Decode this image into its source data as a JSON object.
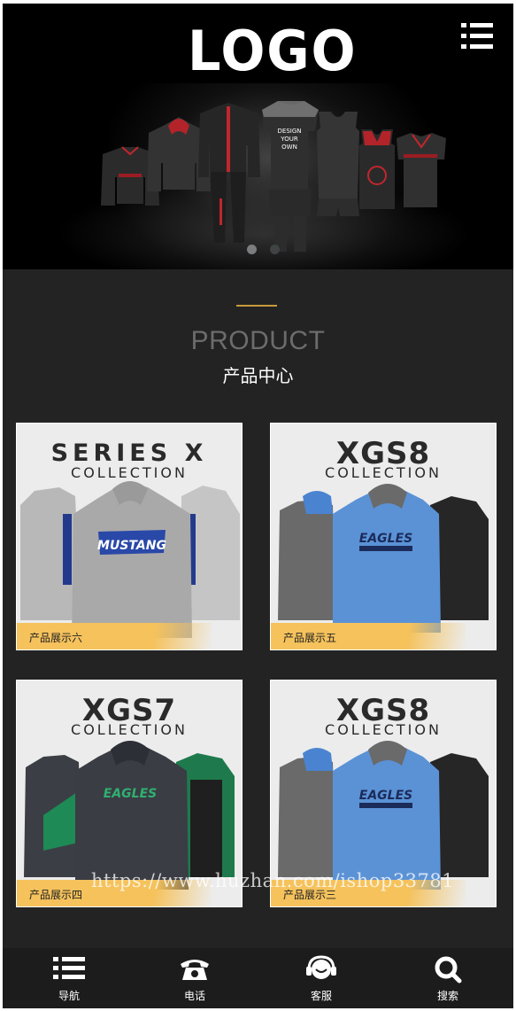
{
  "header": {
    "logo_text": "LOGO",
    "menu_icon": "menu-list-icon"
  },
  "banner": {
    "slide_count": 2,
    "active_slide": 1,
    "garment_texts": {
      "jersey_print": "DESIGN YOUR OWN"
    }
  },
  "section": {
    "title_en": "PRODUCT",
    "title_cn": "产品中心"
  },
  "products": [
    {
      "title": "SERIES X",
      "subtitle": "COLLECTION",
      "label": "产品展示六",
      "print": "MUSTANG",
      "colors": [
        "#b8b8b8",
        "#a9a9a9",
        "#c5c5c5"
      ]
    },
    {
      "title": "XGS8",
      "subtitle": "COLLECTION",
      "label": "产品展示五",
      "print": "EAGLES",
      "colors": [
        "#6a6a6a",
        "#5b92d6",
        "#262626"
      ]
    },
    {
      "title": "XGS7",
      "subtitle": "COLLECTION",
      "label": "产品展示四",
      "print": "EAGLES",
      "colors": [
        "#3b3e44",
        "#3a3d44",
        "#1e7a4c"
      ]
    },
    {
      "title": "XGS8",
      "subtitle": "COLLECTION",
      "label": "产品展示三",
      "print": "EAGLES",
      "colors": [
        "#6a6a6a",
        "#5b92d6",
        "#262626"
      ]
    }
  ],
  "watermark": "https://www.huzhan.com/ishop33781",
  "bottom_nav": [
    {
      "label": "导航",
      "icon": "list-icon"
    },
    {
      "label": "电话",
      "icon": "telephone-icon"
    },
    {
      "label": "客服",
      "icon": "headset-icon"
    },
    {
      "label": "搜索",
      "icon": "search-icon"
    }
  ],
  "colors": {
    "accent": "#c79a3c",
    "label_bg": "#f5c25c",
    "page_bg": "#232323"
  }
}
